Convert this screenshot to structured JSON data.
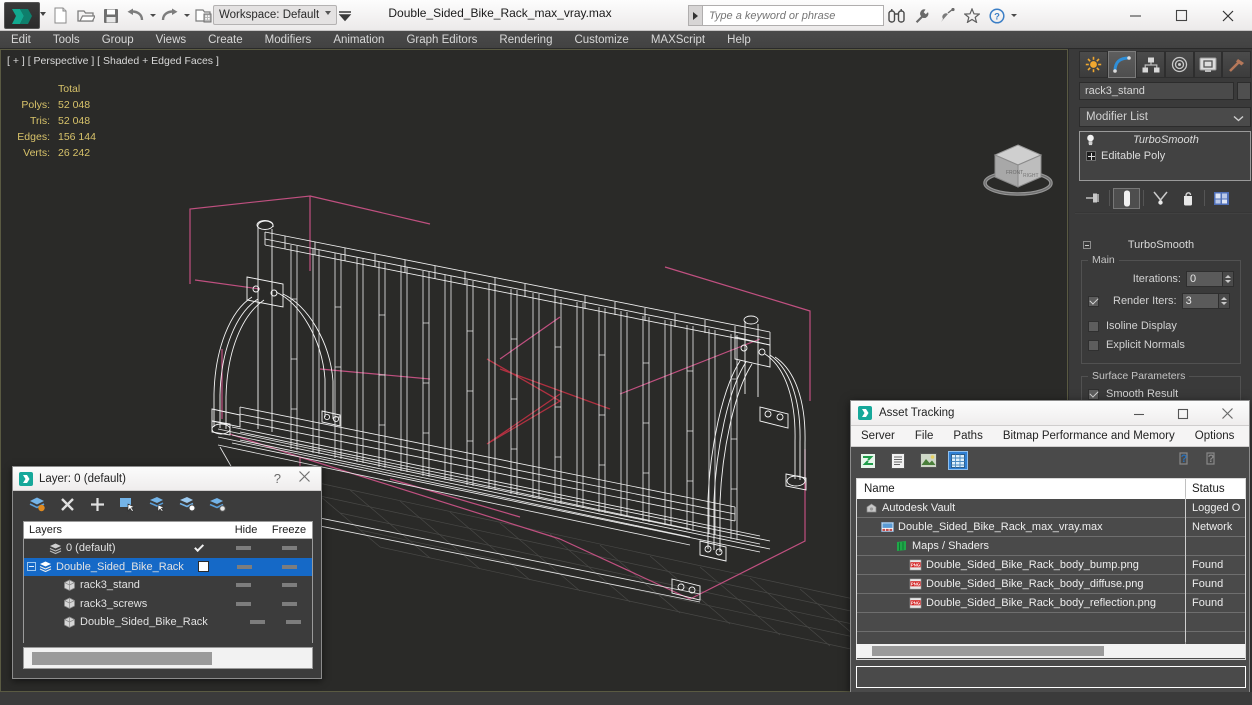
{
  "app": {
    "title": "Double_Sided_Bike_Rack_max_vray.max",
    "workspace": "Workspace: Default",
    "search_placeholder": "Type a keyword or phrase"
  },
  "quick_access": [
    {
      "name": "new-file-icon",
      "label": "New"
    },
    {
      "name": "open-file-icon",
      "label": "Open"
    },
    {
      "name": "save-file-icon",
      "label": "Save"
    },
    {
      "name": "undo-icon",
      "label": "Undo"
    },
    {
      "name": "redo-icon",
      "label": "Redo"
    },
    {
      "name": "set-project-folder-icon",
      "label": "Set Project Folder"
    }
  ],
  "title_icons": [
    {
      "name": "binoculars-icon"
    },
    {
      "name": "wrench-icon"
    },
    {
      "name": "satellite-dish-icon"
    },
    {
      "name": "star-icon"
    },
    {
      "name": "help-icon"
    }
  ],
  "window_buttons": [
    {
      "name": "minimize-button",
      "glyph": "—"
    },
    {
      "name": "maximize-button",
      "glyph": "□"
    },
    {
      "name": "close-button",
      "glyph": "✕"
    }
  ],
  "menu": {
    "items": [
      "Edit",
      "Tools",
      "Group",
      "Views",
      "Create",
      "Modifiers",
      "Animation",
      "Graph Editors",
      "Rendering",
      "Customize",
      "MAXScript",
      "Help"
    ]
  },
  "viewport": {
    "label": "[ + ] [ Perspective ] [ Shaded + Edged Faces ]",
    "stats": {
      "header": "Total",
      "rows": [
        {
          "label": "Polys:",
          "value": "52 048"
        },
        {
          "label": "Tris:",
          "value": "52 048"
        },
        {
          "label": "Edges:",
          "value": "156 144"
        },
        {
          "label": "Verts:",
          "value": "26 242"
        }
      ]
    },
    "viewcube_name": "view-cube"
  },
  "command_panel": {
    "tabs": [
      {
        "name": "tab-create",
        "label": "Create",
        "selected": false
      },
      {
        "name": "tab-modify",
        "label": "Modify",
        "selected": true
      },
      {
        "name": "tab-hierarchy",
        "label": "Hierarchy",
        "selected": false
      },
      {
        "name": "tab-motion",
        "label": "Motion",
        "selected": false
      },
      {
        "name": "tab-display",
        "label": "Display",
        "selected": false
      },
      {
        "name": "tab-utilities",
        "label": "Utilities",
        "selected": false
      }
    ],
    "object_name": "rack3_stand",
    "modifier_list_label": "Modifier List",
    "stack": [
      {
        "name": "TurboSmooth",
        "italic": true
      },
      {
        "name": "Editable Poly",
        "italic": false
      }
    ],
    "stack_buttons": [
      {
        "name": "pin-stack-button"
      },
      {
        "name": "show-end-result-button",
        "active": true
      },
      {
        "name": "make-unique-button"
      },
      {
        "name": "remove-modifier-button"
      },
      {
        "name": "configure-modifier-sets-button"
      }
    ],
    "turbosmooth": {
      "title": "TurboSmooth",
      "main_group": "Main",
      "iterations_label": "Iterations:",
      "iterations_value": "0",
      "render_iters_label": "Render Iters:",
      "render_iters_value": "3",
      "render_iters_checked": true,
      "isoline_display_label": "Isoline Display",
      "isoline_display_checked": false,
      "explicit_normals_label": "Explicit Normals",
      "explicit_normals_checked": false,
      "surface_group": "Surface Parameters",
      "smooth_result_label": "Smooth Result",
      "smooth_result_checked": true
    }
  },
  "layer_dialog": {
    "title": "Layer: 0 (default)",
    "help_glyph": "?",
    "close_glyph": "✕",
    "toolbar": [
      {
        "name": "create-new-layer-icon"
      },
      {
        "name": "delete-layer-icon"
      },
      {
        "name": "add-layer-icon"
      },
      {
        "name": "select-objects-in-layer-icon"
      },
      {
        "name": "highlight-selected-objects-icon"
      },
      {
        "name": "add-selection-to-layer-icon"
      },
      {
        "name": "set-layer-to-selection-icon"
      }
    ],
    "columns": {
      "name": "Layers",
      "hide": "Hide",
      "freeze": "Freeze"
    },
    "rows": [
      {
        "name": "0 (default)",
        "indent": 1,
        "selected": false,
        "expandable": false,
        "check": "tick",
        "hide": "dash",
        "freeze": "dash"
      },
      {
        "name": "Double_Sided_Bike_Rack",
        "indent": 0,
        "selected": true,
        "expandable": true,
        "check": "box",
        "hide": "dash",
        "freeze": "dash"
      },
      {
        "name": "rack3_stand",
        "indent": 2,
        "selected": false,
        "expandable": false,
        "check": "none",
        "hide": "dash",
        "freeze": "dash"
      },
      {
        "name": "rack3_screws",
        "indent": 2,
        "selected": false,
        "expandable": false,
        "check": "none",
        "hide": "dash",
        "freeze": "dash"
      },
      {
        "name": "Double_Sided_Bike_Rack",
        "indent": 2,
        "selected": false,
        "expandable": false,
        "check": "none",
        "hide": "dash",
        "freeze": "dash"
      }
    ]
  },
  "asset_tracking": {
    "title": "Asset Tracking",
    "window_buttons": [
      {
        "name": "asset-minimize-button",
        "glyph": "—"
      },
      {
        "name": "asset-maximize-button",
        "glyph": "□"
      },
      {
        "name": "asset-close-button",
        "glyph": "✕"
      }
    ],
    "menu": [
      "Server",
      "File",
      "Paths",
      "Bitmap Performance and Memory",
      "Options"
    ],
    "toolbar": [
      {
        "name": "refresh-icon",
        "active": false
      },
      {
        "name": "list-view-icon",
        "active": false
      },
      {
        "name": "thumbnail-view-icon",
        "active": false
      },
      {
        "name": "grid-view-icon",
        "active": true
      }
    ],
    "help_icons": [
      {
        "name": "help-blue-icon"
      },
      {
        "name": "help-gray-icon"
      }
    ],
    "columns": {
      "name": "Name",
      "status": "Status"
    },
    "rows": [
      {
        "name": "Autodesk Vault",
        "status": "Logged O",
        "indent": 0,
        "icon": "vault-icon"
      },
      {
        "name": "Double_Sided_Bike_Rack_max_vray.max",
        "status": "Network",
        "indent": 1,
        "icon": "max-file-icon"
      },
      {
        "name": "Maps / Shaders",
        "status": "",
        "indent": 2,
        "icon": "maps-shaders-icon"
      },
      {
        "name": "Double_Sided_Bike_Rack_body_bump.png",
        "status": "Found",
        "indent": 3,
        "icon": "png-icon"
      },
      {
        "name": "Double_Sided_Bike_Rack_body_diffuse.png",
        "status": "Found",
        "indent": 3,
        "icon": "png-icon"
      },
      {
        "name": "Double_Sided_Bike_Rack_body_reflection.png",
        "status": "Found",
        "indent": 3,
        "icon": "png-icon"
      }
    ]
  },
  "colors": {
    "accent_blue": "#1569c7",
    "stat_yellow": "#d8c36a",
    "viewport_bg": "#2a2a28",
    "selection_pink": "#c05080",
    "panel_bg": "#3a3a3a"
  }
}
